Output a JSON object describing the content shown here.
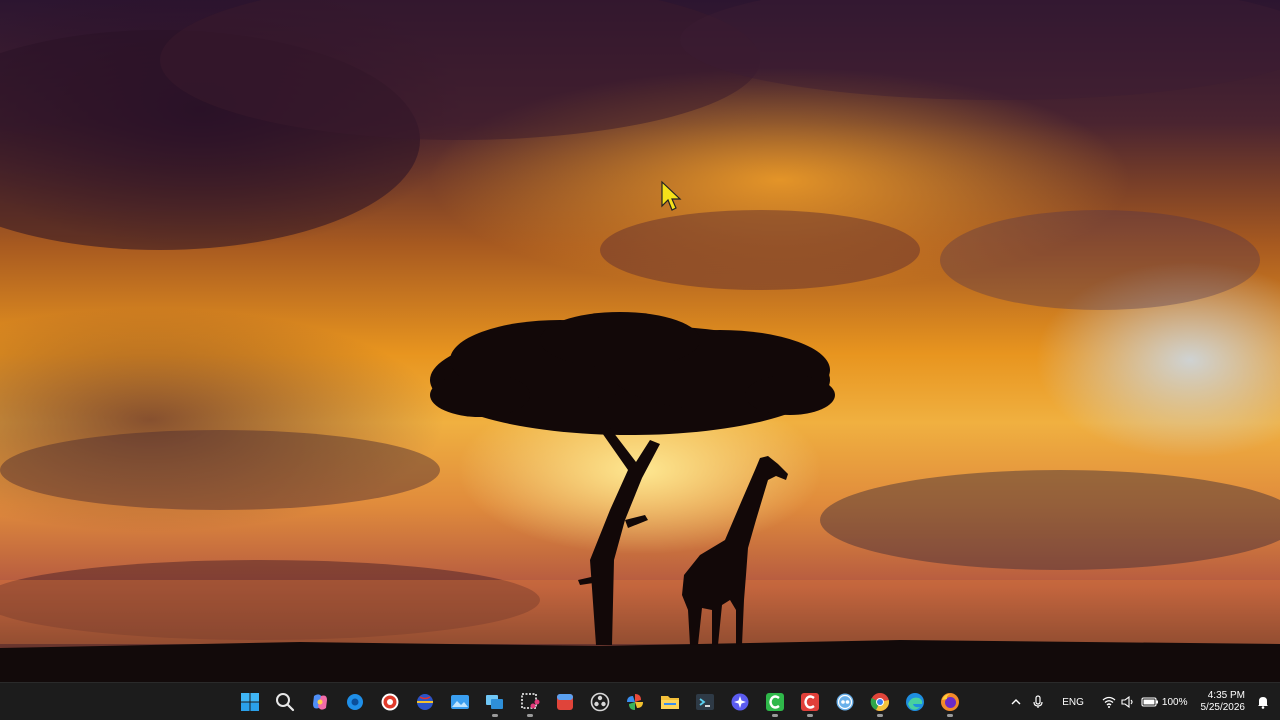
{
  "desktop": {
    "wallpaper": "african-savanna-sunset-acacia-giraffe"
  },
  "cursor": {
    "icon": "arrow-cursor-icon",
    "color": "#f5e11a"
  },
  "taskbar": {
    "background": "#1c1c1c",
    "apps": [
      {
        "name": "start",
        "icon": "windows-start-icon",
        "running": false
      },
      {
        "name": "search",
        "icon": "search-icon",
        "running": false
      },
      {
        "name": "copilot",
        "icon": "copilot-icon",
        "running": false
      },
      {
        "name": "blue-app",
        "icon": "blue-circle-app-icon",
        "running": false
      },
      {
        "name": "screen-recorder",
        "icon": "record-icon",
        "running": false
      },
      {
        "name": "globe-app",
        "icon": "globe-app-icon",
        "running": false
      },
      {
        "name": "photos",
        "icon": "photos-icon",
        "running": false
      },
      {
        "name": "task-view",
        "icon": "task-view-icon",
        "running": true
      },
      {
        "name": "snipping-tool",
        "icon": "snipping-tool-icon",
        "running": true
      },
      {
        "name": "red-app",
        "icon": "red-app-icon",
        "running": false
      },
      {
        "name": "obs",
        "icon": "obs-icon",
        "running": false
      },
      {
        "name": "paint-app",
        "icon": "pinwheel-icon",
        "running": false
      },
      {
        "name": "file-explorer",
        "icon": "folder-icon",
        "running": false
      },
      {
        "name": "terminal",
        "icon": "terminal-icon",
        "running": false
      },
      {
        "name": "purple-app",
        "icon": "purple-circle-icon",
        "running": false
      },
      {
        "name": "green-c-app",
        "icon": "green-c-icon",
        "running": true
      },
      {
        "name": "red-c-app",
        "icon": "red-c-icon",
        "running": true
      },
      {
        "name": "qbittorrent",
        "icon": "qb-icon",
        "running": false
      },
      {
        "name": "chrome",
        "icon": "chrome-icon",
        "running": true
      },
      {
        "name": "edge",
        "icon": "edge-icon",
        "running": false
      },
      {
        "name": "firefox",
        "icon": "firefox-icon",
        "running": true
      }
    ],
    "tray": {
      "chevron_icon": "chevron-up-icon",
      "mic_icon": "microphone-icon",
      "language": "ENG",
      "wifi_icon": "wifi-icon",
      "volume_icon": "volume-icon",
      "battery_icon": "battery-icon",
      "battery_percent": "100%",
      "time": "4:35 PM",
      "date": "5/25/2026",
      "notification_icon": "notification-bell-icon"
    }
  }
}
